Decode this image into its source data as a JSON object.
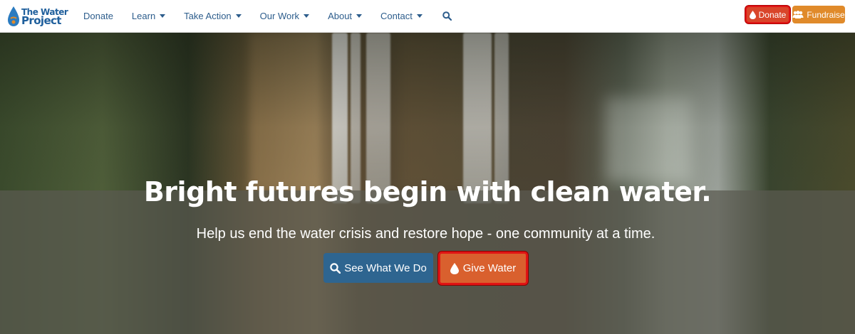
{
  "logo": {
    "line1": "The Water",
    "line2": "Project",
    "icon": "water-drop-logo-icon"
  },
  "nav": {
    "items": [
      {
        "label": "Donate",
        "has_caret": false
      },
      {
        "label": "Learn",
        "has_caret": true
      },
      {
        "label": "Take Action",
        "has_caret": true
      },
      {
        "label": "Our Work",
        "has_caret": true
      },
      {
        "label": "About",
        "has_caret": true
      },
      {
        "label": "Contact",
        "has_caret": true
      }
    ],
    "search_icon": "search-icon"
  },
  "header_buttons": {
    "donate_label": "Donate",
    "fundraise_label": "Fundraise"
  },
  "hero": {
    "headline": "Bright futures begin with clean water.",
    "subline": "Help us end the water crisis and restore hope - one community at a time.",
    "see_button_label": "See What We Do",
    "give_button_label": "Give Water"
  },
  "colors": {
    "brand_blue": "#2d5d8c",
    "donate_red": "#d9452a",
    "fundraise_orange": "#e08a2a",
    "give_orange": "#d9602e",
    "see_blue": "#2e6590",
    "highlight_red": "#e01414"
  }
}
